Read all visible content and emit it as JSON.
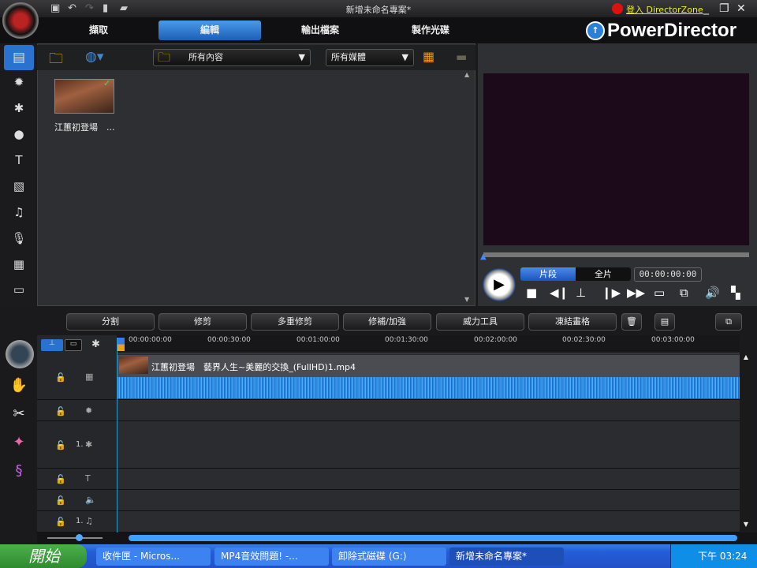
{
  "window": {
    "title": "新增未命名專案*",
    "login_link": "登入 DirectorZone",
    "brand": "PowerDirector"
  },
  "tabs": [
    {
      "label": "擷取"
    },
    {
      "label": "編輯",
      "active": true
    },
    {
      "label": "輸出檔案"
    },
    {
      "label": "製作光碟"
    }
  ],
  "library": {
    "folder_filter": "所有內容",
    "media_filter": "所有媒體",
    "items": [
      {
        "caption": "江蕙初登場　..."
      }
    ]
  },
  "preview": {
    "mode_clip": "片段",
    "mode_movie": "全片",
    "timecode": "00:00:00:00"
  },
  "toolbar": {
    "split": "分割",
    "trim": "修剪",
    "multi_trim": "多重修剪",
    "fix_enhance": "修補/加強",
    "power_tools": "威力工具",
    "freeze_frame": "凍結畫格"
  },
  "timeline": {
    "ticks": [
      "00:00:00:00",
      "00:00:30:00",
      "00:01:00:00",
      "00:01:30:00",
      "00:02:00:00",
      "00:02:30:00",
      "00:03:00:00"
    ],
    "clip": {
      "label": "江蕙初登場　藝界人生~美麗的交換_(FullHD)1.mp4"
    },
    "pip_track_num": "1.",
    "music_track_num": "1."
  },
  "taskbar": {
    "start": "開始",
    "tasks": [
      "收件匣 - Micros...",
      "MP4音效問題! -...",
      "卸除式磁碟 (G:)",
      "新增未命名專案*"
    ],
    "clock": "下午 03:24"
  },
  "colors": {
    "accent": "#2a7fd8",
    "waveform": "#2a8fe8"
  }
}
